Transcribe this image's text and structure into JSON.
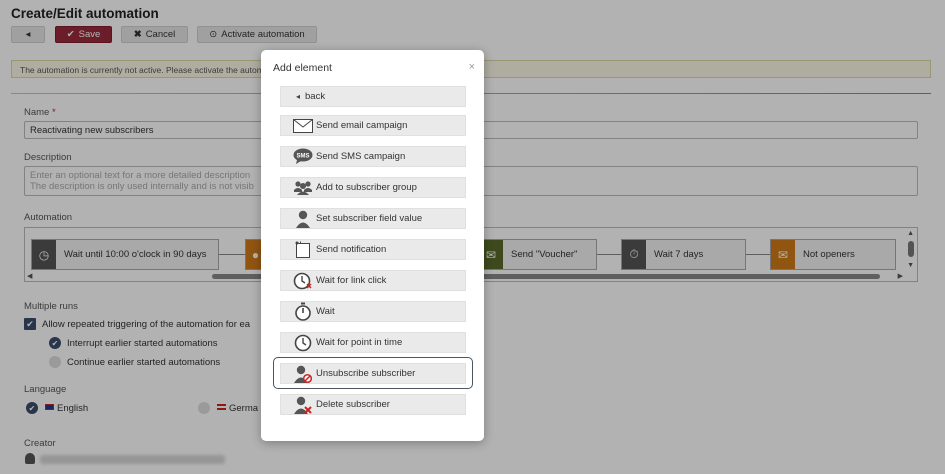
{
  "page": {
    "title": "Create/Edit automation"
  },
  "toolbar": {
    "back_label": "◂",
    "save_label": "Save",
    "cancel_label": "Cancel",
    "activate_label": "Activate automation"
  },
  "notice": {
    "text": "The automation is currently not active. Please activate the autom"
  },
  "form": {
    "name_label": "Name",
    "name_required": "*",
    "name_value": "Reactivating new subscribers",
    "description_label": "Description",
    "description_placeholder_line1": "Enter an optional text for a more detailed description",
    "description_placeholder_line2": "The description is only used internally and is not visib",
    "automation_label": "Automation",
    "multiple_runs_label": "Multiple runs",
    "allow_repeat_label": "Allow repeated triggering of the automation for ea",
    "interrupt_label": "Interrupt earlier started automations",
    "continue_label": "Continue earlier started automations",
    "language_label": "Language",
    "lang_english": "English",
    "lang_german": "Germa",
    "creator_label": "Creator"
  },
  "flow": {
    "nodes": [
      {
        "label": "Wait until 10:00 o'clock in 90 days",
        "icon": "clock-icon",
        "color": "#555555"
      },
      {
        "label": "",
        "icon": "group-icon",
        "color": "#d07a1a"
      },
      {
        "label": "Send \"Voucher\"",
        "icon": "email-icon",
        "color": "#5a6b2a"
      },
      {
        "label": "Wait 7 days",
        "icon": "stopwatch-icon",
        "color": "#555555"
      },
      {
        "label": "Not openers",
        "icon": "envelope-open-icon",
        "color": "#d07a1a"
      }
    ]
  },
  "modal": {
    "title": "Add element",
    "close": "×",
    "options": [
      {
        "label": "back",
        "icon": "chevron-left-icon"
      },
      {
        "label": "Send email campaign",
        "icon": "envelope-icon"
      },
      {
        "label": "Send SMS campaign",
        "icon": "sms-icon"
      },
      {
        "label": "Add to subscriber group",
        "icon": "group-icon"
      },
      {
        "label": "Set subscriber field value",
        "icon": "user-icon"
      },
      {
        "label": "Send notification",
        "icon": "notification-icon"
      },
      {
        "label": "Wait for link click",
        "icon": "clock-link-icon"
      },
      {
        "label": "Wait",
        "icon": "stopwatch-icon"
      },
      {
        "label": "Wait for point in time",
        "icon": "clock-icon"
      },
      {
        "label": "Unsubscribe subscriber",
        "icon": "user-unsubscribe-icon"
      },
      {
        "label": "Delete subscriber",
        "icon": "user-delete-icon"
      }
    ]
  }
}
